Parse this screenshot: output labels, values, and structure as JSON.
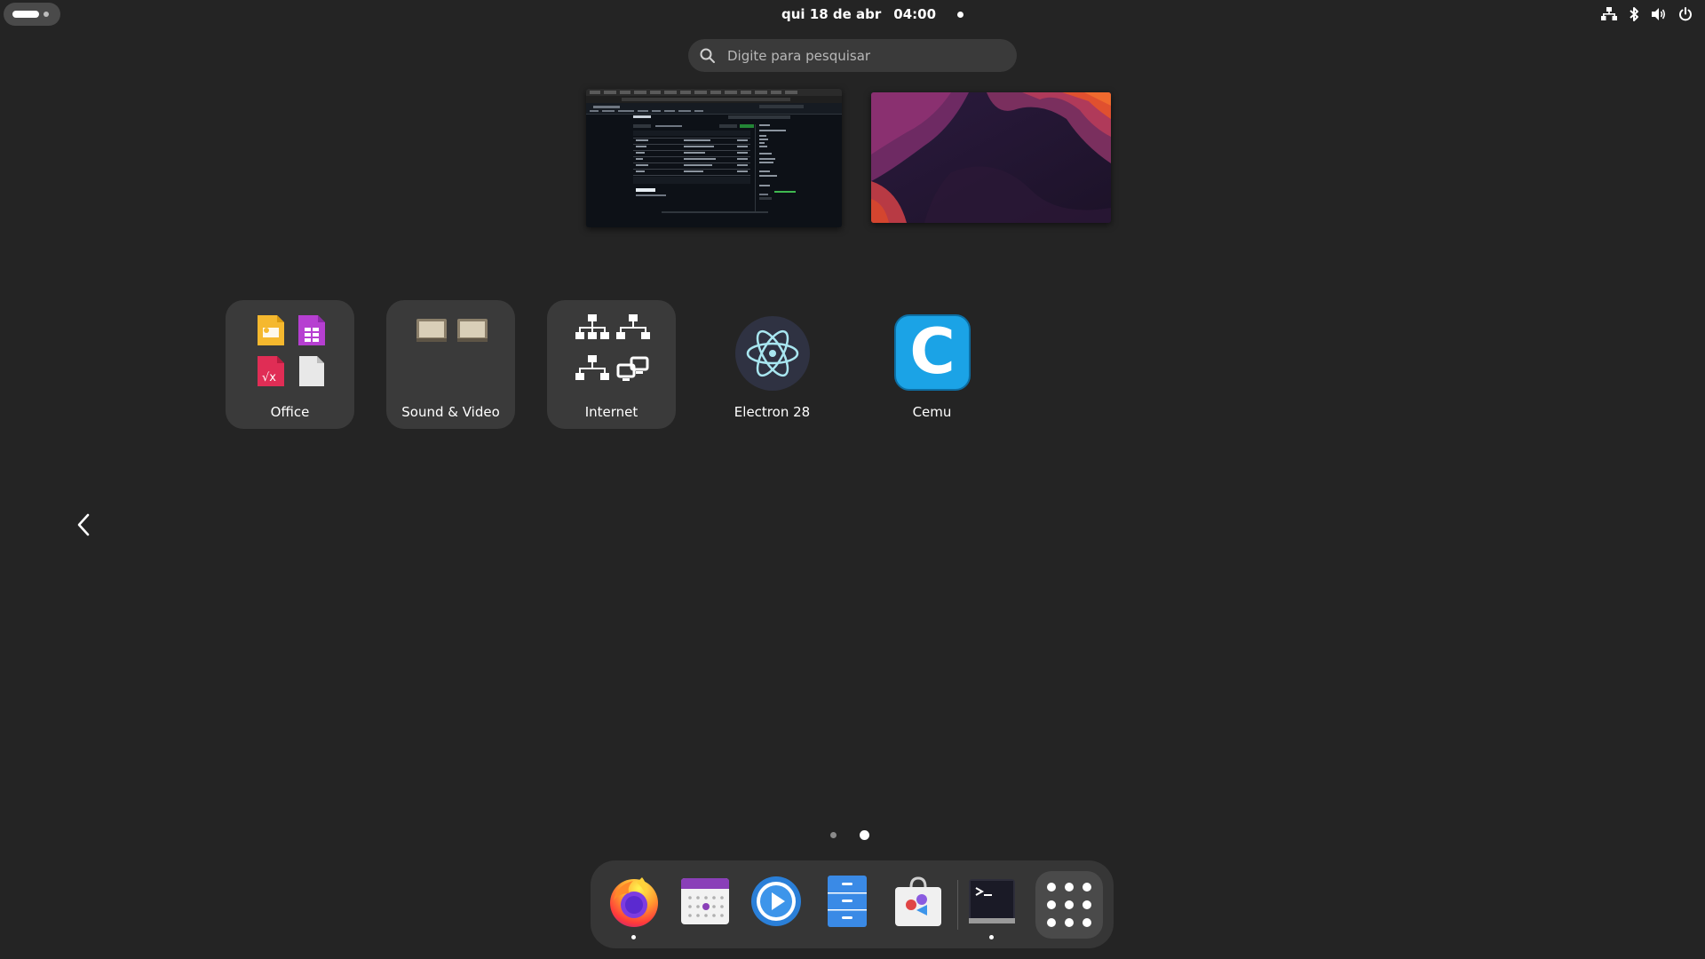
{
  "topbar": {
    "clock_date": "qui 18 de abr",
    "clock_time": "04:00"
  },
  "search": {
    "placeholder": "Digite para pesquisar"
  },
  "app_grid": {
    "apps": [
      {
        "label": "Office",
        "kind": "folder"
      },
      {
        "label": "Sound & Video",
        "kind": "folder"
      },
      {
        "label": "Internet",
        "kind": "folder"
      },
      {
        "label": "Electron 28",
        "kind": "app"
      },
      {
        "label": "Cemu",
        "kind": "app"
      }
    ],
    "page_count": 2,
    "current_page": 2
  },
  "dock": {
    "items": [
      {
        "icon": "firefox-icon",
        "running": true
      },
      {
        "icon": "calendar-icon",
        "running": false
      },
      {
        "icon": "media-player-icon",
        "running": false
      },
      {
        "icon": "file-manager-icon",
        "running": false
      },
      {
        "icon": "software-store-icon",
        "running": false
      },
      {
        "icon": "terminal-icon",
        "running": true
      }
    ]
  },
  "colors": {
    "background": "#242424",
    "folder_bg": "#3a3a3a",
    "dock_bg": "#363636",
    "cemu_blue": "#1ba3e6"
  }
}
